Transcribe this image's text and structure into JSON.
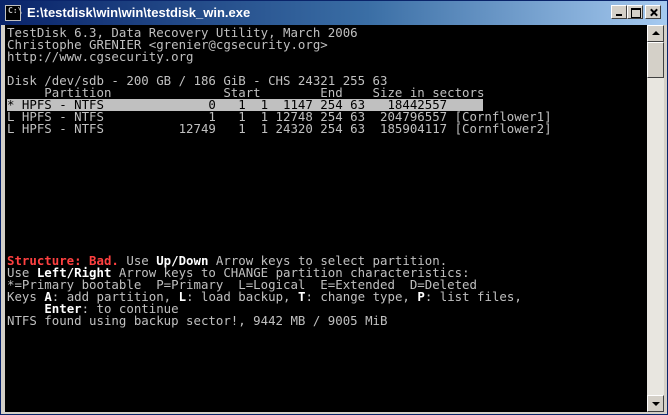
{
  "window": {
    "title": "E:\\testdisk\\win\\win\\testdisk_win.exe",
    "icon_label": "C:\\"
  },
  "console": {
    "header": [
      "TestDisk 6.3, Data Recovery Utility, March 2006",
      "Christophe GRENIER <grenier@cgsecurity.org>",
      "http://www.cgsecurity.org"
    ],
    "disk_info": "Disk /dev/sdb - 200 GB / 186 GiB - CHS 24321 255 63",
    "table_header": "     Partition               Start        End    Size in sectors",
    "partitions": [
      "* HPFS - NTFS              0   1  1  1147 254 63   18442557",
      "L HPFS - NTFS              1   1  1 12748 254 63  204796557 [Cornflower1]",
      "L HPFS - NTFS          12749   1  1 24320 254 63  185904117 [Cornflower2]"
    ],
    "status": {
      "structure_label": "Structure: Bad.",
      "use_1": " Use ",
      "updown": "Up/Down",
      "rest_1": " Arrow keys to select partition.",
      "use_2": "Use ",
      "leftright": "Left/Right",
      "rest_2": " Arrow keys to CHANGE partition characteristics:",
      "legend": "*=Primary bootable  P=Primary  L=Logical  E=Extended  D=Deleted",
      "keys_prefix": "Keys ",
      "key_a": "A",
      "keys_a_text": ": add partition, ",
      "key_l": "L",
      "keys_l_text": ": load backup, ",
      "key_t": "T",
      "keys_t_text": ": change type, ",
      "key_p": "P",
      "keys_p_text": ": list files,",
      "enter_indent": "     ",
      "key_enter": "Enter",
      "enter_text": ": to continue",
      "ntfs_found": "NTFS found using backup sector!, 9442 MB / 9005 MiB"
    }
  },
  "colors": {
    "console_bg": "#000000",
    "console_text": "#c0c0c0",
    "highlight": "#ffffff",
    "error": "#ff4040",
    "title_gradient_start": "#0a246a"
  }
}
